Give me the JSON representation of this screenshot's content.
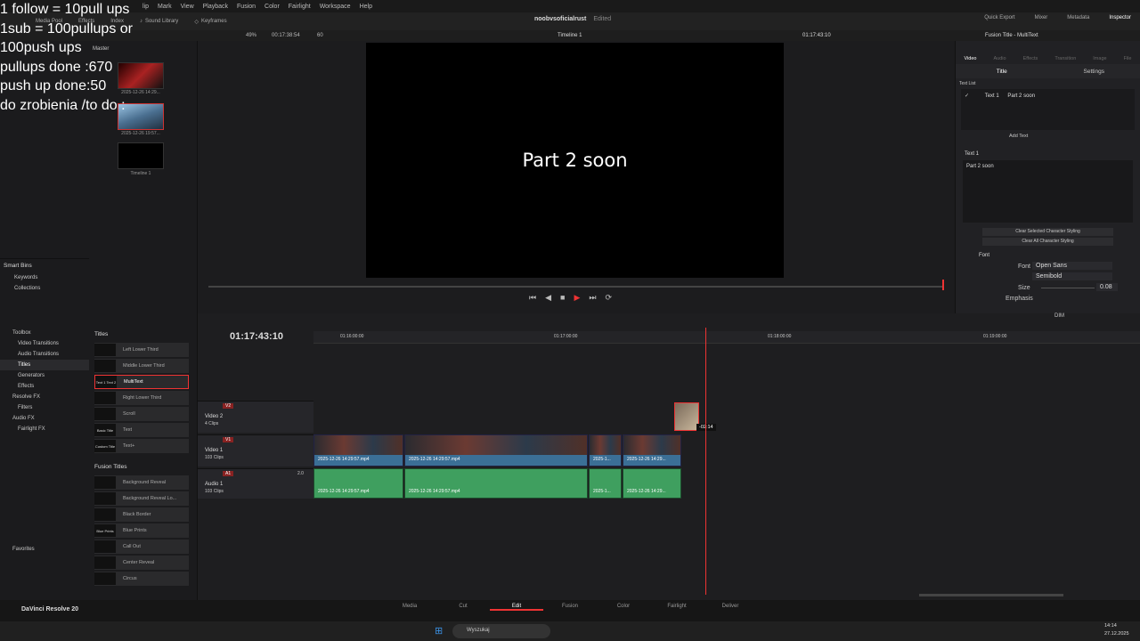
{
  "overlay_lines": [
    "1 follow = 10pull ups",
    "1sub = 100pullups or",
    "100push ups",
    "pullups done :670",
    "push up done:50",
    "do zrobienia /to do :"
  ],
  "menu": [
    "lip",
    "Mark",
    "View",
    "Playback",
    "Fusion",
    "Color",
    "Fairlight",
    "Workspace",
    "Help"
  ],
  "toolbar": {
    "left": [
      "Media Pool",
      "Effects",
      "Index",
      "Sound Library",
      "Keyframes"
    ],
    "project": "noobvsoficialrust",
    "status": "Edited",
    "right": [
      "Quick Export",
      "Mixer",
      "Metadata",
      "Inspector"
    ]
  },
  "subbar": {
    "zoom": "49%",
    "timecode": "00:17:38:54",
    "fps": "60",
    "timeline_name": "Timeline 1",
    "right_timecode": "01:17:43:10",
    "inspector_title": "Fusion Title - MultiText"
  },
  "mediapool": {
    "master": "Master",
    "thumbs": [
      {
        "label": "2025-12-26 14:29..."
      },
      {
        "label": "2025-12-26 19:57..."
      },
      {
        "label": "Timeline 1"
      }
    ],
    "smart_bins": "Smart Bins",
    "bins": [
      "Keywords",
      "Collections"
    ]
  },
  "viewer_text": "Part 2 soon",
  "inspector": {
    "tabs": [
      "Video",
      "Audio",
      "Effects",
      "Transition",
      "Image",
      "File"
    ],
    "subtabs": [
      "Title",
      "Settings"
    ],
    "text_list": "Text List",
    "text_row": [
      "Text 1",
      "Part 2 soon"
    ],
    "add_text": "Add Text",
    "text_section": "Text 1",
    "text_value": "Part 2 soon",
    "btn_clear_sel": "Clear Selected Character Styling",
    "btn_clear_all": "Clear All Character Styling",
    "font_section": "Font",
    "font_label": "Font",
    "font_value": "Open Sans",
    "weight_value": "Semibold",
    "size_label": "Size",
    "size_value": "0.08",
    "emphasis_label": "Emphasis",
    "color_label": "Color"
  },
  "effects": {
    "tree": [
      "Toolbox",
      "Video Transitions",
      "Audio Transitions",
      "Titles",
      "Generators",
      "Effects",
      "Resolve FX",
      "Filters",
      "Audio FX",
      "Fairlight FX"
    ],
    "favorites": "Favorites",
    "titles_header": "Titles",
    "titles": [
      "Left Lower Third",
      "Middle Lower Third",
      "MultiText",
      "Right Lower Third",
      "Scroll",
      "Text",
      "Text+"
    ],
    "title_thumbs": [
      "",
      "",
      "Text 1 Text 2",
      "",
      "",
      "Basic Title",
      "Custom Title"
    ],
    "fusion_header": "Fusion Titles",
    "fusion": [
      "Background Reveal",
      "Background Reveal Lo...",
      "Black Border",
      "Blue Prints",
      "Call Out",
      "Center Reveal",
      "Circus"
    ],
    "fusion_thumbs": [
      "",
      "",
      "",
      "Blue Prints",
      "",
      "",
      ""
    ]
  },
  "timeline": {
    "timecode": "01:17:43:10",
    "ruler": [
      "01:16:00:00",
      "01:17:00:00",
      "01:18:00:00",
      "01:19:00:00"
    ],
    "tracks": [
      {
        "id": "V2",
        "name": "Video 2",
        "sub": "4 Clips"
      },
      {
        "id": "V1",
        "name": "Video 1",
        "sub": "103 Clips"
      },
      {
        "id": "A1",
        "name": "Audio 1",
        "sub": "103 Clips",
        "ch": "2.0"
      }
    ],
    "video_clips": [
      "2025-12-26 14:29:57.mp4",
      "2025-12-26 14:29:57.mp4",
      "2025-1...",
      "2025-12-26 14:29..."
    ],
    "audio_clips": [
      "2025-12-26 14:29:57.mp4",
      "2025-12-26 14:29:57.mp4",
      "2025-1...",
      "2025-12-26 14:29..."
    ],
    "drag_badge": "-02:14",
    "dim": "DIM"
  },
  "pages": [
    "Media",
    "Cut",
    "Edit",
    "Fusion",
    "Color",
    "Fairlight",
    "Deliver"
  ],
  "app_name": "DaVinci Resolve 20",
  "taskbar": {
    "search": "Wyszukaj",
    "time": "14:14",
    "date": "27.12.2025"
  }
}
